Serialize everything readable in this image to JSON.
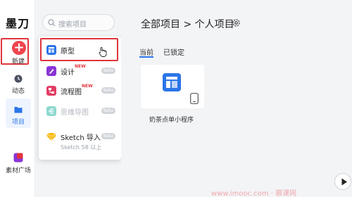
{
  "app": {
    "logo": "墨刀"
  },
  "rail": {
    "new_label": "新建",
    "items": [
      {
        "label": "动态",
        "icon": "clock-icon"
      },
      {
        "label": "项目",
        "icon": "folder-icon"
      },
      {
        "label": "素材广场",
        "icon": "material-icon"
      }
    ]
  },
  "search": {
    "placeholder": "搜索项目"
  },
  "new_menu": {
    "items": [
      {
        "label": "原型",
        "icon": "prototype-icon",
        "color": "#2b75e8"
      },
      {
        "label": "设计",
        "icon": "design-icon",
        "color": "#8a35d6",
        "tag": "NEW",
        "badge": "Beta"
      },
      {
        "label": "流程图",
        "icon": "flowchart-icon",
        "color": "#e23d64",
        "tag": "NEW",
        "badge": "Beta"
      },
      {
        "label": "思维导图",
        "icon": "mindmap-icon",
        "color": "#8fd9d0",
        "badge": "Beta"
      },
      {
        "label": "Sketch 导入",
        "icon": "sketch-icon",
        "color": "#f7b500",
        "badge": "Beta",
        "sub": "Sketch 58 以上"
      }
    ]
  },
  "main": {
    "breadcrumb": "全部项目 > 个人项目",
    "tabs": [
      {
        "label": "当前",
        "active": true
      },
      {
        "label": "已锁定",
        "active": false
      }
    ],
    "project": {
      "title": "奶茶点单小程序"
    }
  },
  "watermark": "www.imooc.com  ·  慕课网"
}
